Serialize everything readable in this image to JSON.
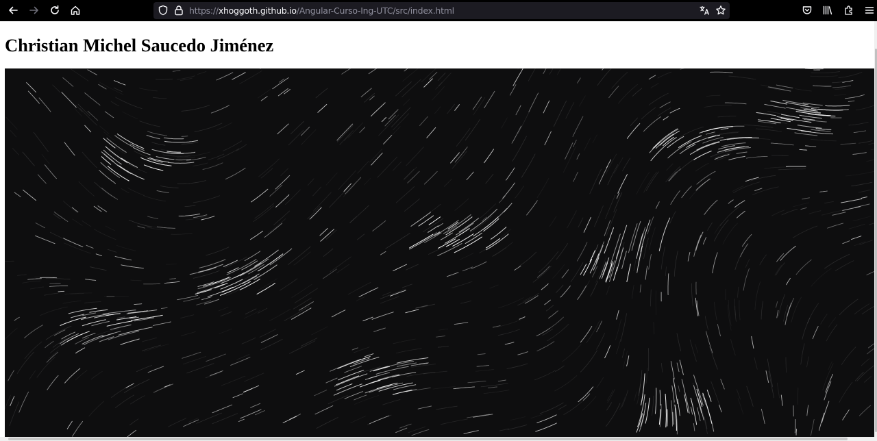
{
  "browser": {
    "url_prefix": "https://",
    "url_host": "xhoggoth.github.io",
    "url_path": "/Angular-Curso-Ing-UTC/src/index.html",
    "icons": {
      "back": "arrow-left-icon",
      "forward": "arrow-right-icon",
      "reload": "reload-icon",
      "home": "home-icon",
      "tracking_protection": "shield-icon",
      "security": "lock-icon",
      "translate": "translate-icon",
      "bookmark": "star-icon",
      "pocket": "pocket-icon",
      "library": "library-icon",
      "extensions": "extensions-icon",
      "menu": "hamburger-menu-icon"
    }
  },
  "page": {
    "title": "Christian Michel Saucedo Jiménez",
    "canvas_background": "#0e0e0f",
    "stroke_color": "#ffffff"
  }
}
